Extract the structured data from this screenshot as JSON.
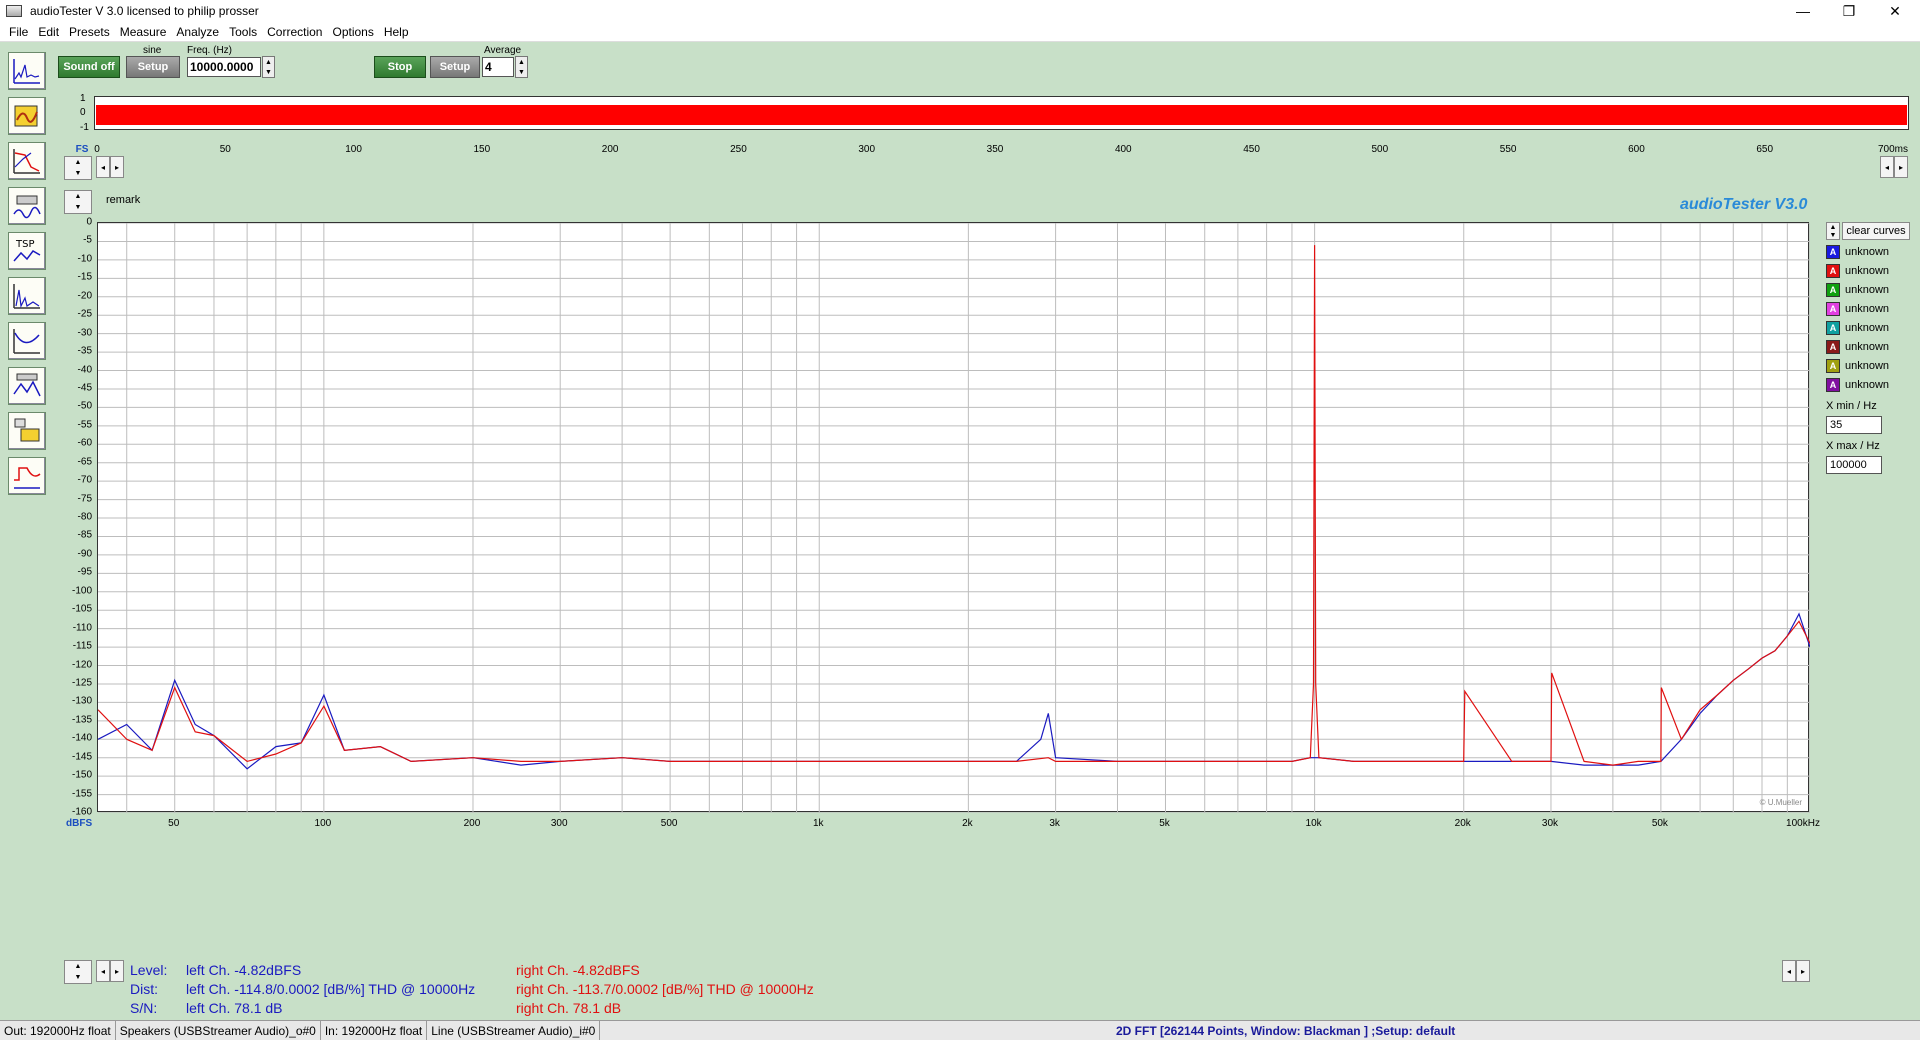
{
  "window": {
    "title": "audioTester  V 3.0   licensed to philip prosser",
    "minimize": "—",
    "restore": "❐",
    "close": "✕"
  },
  "menu": [
    "File",
    "Edit",
    "Presets",
    "Measure",
    "Analyze",
    "Tools",
    "Correction",
    "Options",
    "Help"
  ],
  "generator": {
    "sound_off": "Sound off",
    "setup": "Setup",
    "waveform": "sine",
    "freq_label": "Freq. (Hz)",
    "freq_value": "10000.0000"
  },
  "analyzer": {
    "stop": "Stop",
    "setup": "Setup",
    "average_label": "Average",
    "average_value": "4"
  },
  "scope": {
    "y_ticks": [
      "1",
      "0",
      "-1"
    ],
    "fs_label": "FS",
    "x_ticks": [
      "0",
      "50",
      "100",
      "150",
      "200",
      "250",
      "300",
      "350",
      "400",
      "450",
      "500",
      "550",
      "600",
      "650",
      "700ms"
    ]
  },
  "remark": "remark",
  "brand": "audioTester  V3.0",
  "copyright": "© U.Mueller",
  "legend": {
    "clear": "clear curves",
    "items": [
      {
        "label": "unknown",
        "color": "#1a1ae0"
      },
      {
        "label": "unknown",
        "color": "#e01010"
      },
      {
        "label": "unknown",
        "color": "#10a010"
      },
      {
        "label": "unknown",
        "color": "#e040e0"
      },
      {
        "label": "unknown",
        "color": "#10a0a0"
      },
      {
        "label": "unknown",
        "color": "#8a1a1a"
      },
      {
        "label": "unknown",
        "color": "#a0a010"
      },
      {
        "label": "unknown",
        "color": "#8010a0"
      }
    ],
    "xmin_label": "X min / Hz",
    "xmin_value": "35",
    "xmax_label": "X max / Hz",
    "xmax_value": "100000"
  },
  "chart_data": {
    "type": "line",
    "ylabel": "dBFS",
    "xscale": "log",
    "xlim": [
      35,
      100000
    ],
    "ylim": [
      -160,
      0
    ],
    "y_ticks": [
      "0",
      "-5",
      "-10",
      "-15",
      "-20",
      "-25",
      "-30",
      "-35",
      "-40",
      "-45",
      "-50",
      "-55",
      "-60",
      "-65",
      "-70",
      "-75",
      "-80",
      "-85",
      "-90",
      "-95",
      "-100",
      "-105",
      "-110",
      "-115",
      "-120",
      "-125",
      "-130",
      "-135",
      "-140",
      "-145",
      "-150",
      "-155",
      "-160"
    ],
    "x_ticks": [
      {
        "value": 50,
        "label": "50"
      },
      {
        "value": 100,
        "label": "100"
      },
      {
        "value": 200,
        "label": "200"
      },
      {
        "value": 300,
        "label": "300"
      },
      {
        "value": 500,
        "label": "500"
      },
      {
        "value": 1000,
        "label": "1k"
      },
      {
        "value": 2000,
        "label": "2k"
      },
      {
        "value": 3000,
        "label": "3k"
      },
      {
        "value": 5000,
        "label": "5k"
      },
      {
        "value": 10000,
        "label": "10k"
      },
      {
        "value": 20000,
        "label": "20k"
      },
      {
        "value": 30000,
        "label": "30k"
      },
      {
        "value": 50000,
        "label": "50k"
      },
      {
        "value": 100000,
        "label": "100kHz"
      }
    ],
    "grid": true,
    "series": [
      {
        "color": "#1a1ac0",
        "x": [
          35,
          40,
          45,
          50,
          55,
          60,
          70,
          80,
          90,
          100,
          110,
          130,
          150,
          200,
          250,
          300,
          400,
          500,
          700,
          1000,
          1500,
          2000,
          2500,
          2800,
          2900,
          3000,
          4000,
          5000,
          7000,
          9000,
          9800,
          10000,
          10200,
          12000,
          15000,
          20000,
          25000,
          30000,
          35000,
          40000,
          45000,
          50000,
          55000,
          60000,
          65000,
          70000,
          75000,
          80000,
          85000,
          90000,
          95000,
          100000
        ],
        "y": [
          -140,
          -136,
          -143,
          -124,
          -136,
          -139,
          -148,
          -142,
          -141,
          -128,
          -143,
          -142,
          -146,
          -145,
          -147,
          -146,
          -145,
          -146,
          -146,
          -146,
          -146,
          -146,
          -146,
          -140,
          -133,
          -145,
          -146,
          -146,
          -146,
          -146,
          -145,
          -145,
          -145,
          -146,
          -146,
          -146,
          -146,
          -146,
          -147,
          -147,
          -147,
          -146,
          -140,
          -133,
          -128,
          -124,
          -121,
          -118,
          -116,
          -112,
          -106,
          -115
        ]
      },
      {
        "color": "#e01010",
        "x": [
          35,
          40,
          45,
          50,
          55,
          60,
          70,
          80,
          90,
          100,
          110,
          130,
          150,
          200,
          250,
          300,
          400,
          500,
          700,
          1000,
          1500,
          2000,
          2500,
          2900,
          3000,
          4000,
          5000,
          7000,
          9000,
          9800,
          9950,
          10000,
          10050,
          10200,
          12000,
          15000,
          20000,
          20100,
          25000,
          30000,
          30100,
          35000,
          40000,
          45000,
          50000,
          50100,
          55000,
          60000,
          65000,
          70000,
          75000,
          80000,
          85000,
          90000,
          95000,
          100000
        ],
        "y": [
          -132,
          -140,
          -143,
          -126,
          -138,
          -139,
          -146,
          -144,
          -141,
          -131,
          -143,
          -142,
          -146,
          -145,
          -146,
          -146,
          -145,
          -146,
          -146,
          -146,
          -146,
          -146,
          -146,
          -145,
          -146,
          -146,
          -146,
          -146,
          -146,
          -145,
          -125,
          -6,
          -125,
          -145,
          -146,
          -146,
          -146,
          -127,
          -146,
          -146,
          -122,
          -146,
          -147,
          -146,
          -146,
          -126,
          -140,
          -132,
          -128,
          -124,
          -121,
          -118,
          -116,
          -112,
          -108,
          -114
        ]
      }
    ]
  },
  "results": {
    "level_label": "Level:",
    "dist_label": "Dist:",
    "sn_label": "S/N:",
    "left_level": "left Ch. -4.82dBFS",
    "left_dist": "left Ch. -114.8/0.0002 [dB/%] THD @ 10000Hz",
    "left_sn": "left Ch. 78.1 dB",
    "right_level": "right Ch. -4.82dBFS",
    "right_dist": "right Ch. -113.7/0.0002 [dB/%] THD @ 10000Hz",
    "right_sn": "right Ch. 78.1 dB"
  },
  "status": {
    "out": "Out: 192000Hz float",
    "speakers": "Speakers (USBStreamer Audio)_o#0",
    "in": "In: 192000Hz float",
    "line": "Line (USBStreamer Audio)_i#0",
    "mode": "2D FFT [262144 Points, Window: Blackman ] ;Setup:  default"
  }
}
